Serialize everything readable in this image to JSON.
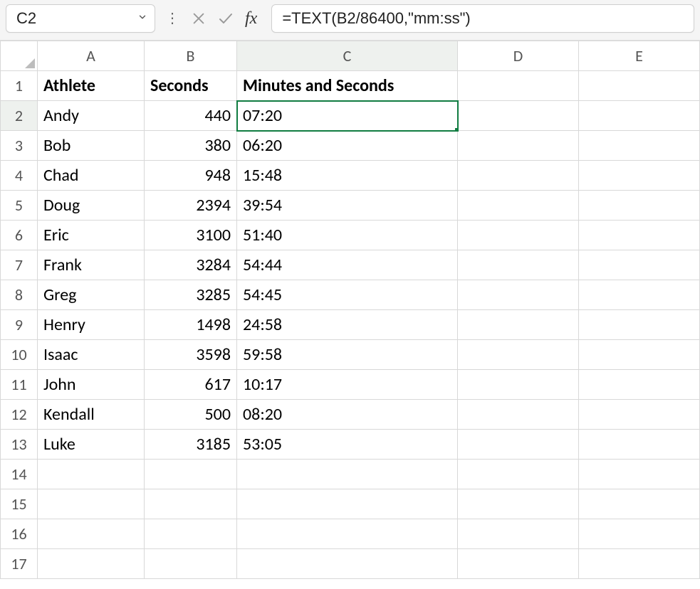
{
  "name_box": {
    "value": "C2"
  },
  "formula_bar": {
    "value": "=TEXT(B2/86400,\"mm:ss\")"
  },
  "fx_label": "fx",
  "columns": [
    "A",
    "B",
    "C",
    "D",
    "E"
  ],
  "visible_row_count": 17,
  "active": {
    "col": "C",
    "row": 2
  },
  "headers": {
    "A": "Athlete",
    "B": "Seconds",
    "C": "Minutes and Seconds"
  },
  "rows": [
    {
      "n": 1,
      "A": "Athlete",
      "B": "Seconds",
      "C": "Minutes and Seconds",
      "D": "",
      "E": "",
      "bold": true
    },
    {
      "n": 2,
      "A": "Andy",
      "B": "440",
      "C": "07:20",
      "D": "",
      "E": ""
    },
    {
      "n": 3,
      "A": "Bob",
      "B": "380",
      "C": "06:20",
      "D": "",
      "E": ""
    },
    {
      "n": 4,
      "A": "Chad",
      "B": "948",
      "C": "15:48",
      "D": "",
      "E": ""
    },
    {
      "n": 5,
      "A": "Doug",
      "B": "2394",
      "C": "39:54",
      "D": "",
      "E": ""
    },
    {
      "n": 6,
      "A": "Eric",
      "B": "3100",
      "C": "51:40",
      "D": "",
      "E": ""
    },
    {
      "n": 7,
      "A": "Frank",
      "B": "3284",
      "C": "54:44",
      "D": "",
      "E": ""
    },
    {
      "n": 8,
      "A": "Greg",
      "B": "3285",
      "C": "54:45",
      "D": "",
      "E": ""
    },
    {
      "n": 9,
      "A": "Henry",
      "B": "1498",
      "C": "24:58",
      "D": "",
      "E": ""
    },
    {
      "n": 10,
      "A": "Isaac",
      "B": "3598",
      "C": "59:58",
      "D": "",
      "E": ""
    },
    {
      "n": 11,
      "A": "John",
      "B": "617",
      "C": "10:17",
      "D": "",
      "E": ""
    },
    {
      "n": 12,
      "A": "Kendall",
      "B": "500",
      "C": "08:20",
      "D": "",
      "E": ""
    },
    {
      "n": 13,
      "A": "Luke",
      "B": "3185",
      "C": "53:05",
      "D": "",
      "E": ""
    },
    {
      "n": 14,
      "A": "",
      "B": "",
      "C": "",
      "D": "",
      "E": ""
    },
    {
      "n": 15,
      "A": "",
      "B": "",
      "C": "",
      "D": "",
      "E": ""
    },
    {
      "n": 16,
      "A": "",
      "B": "",
      "C": "",
      "D": "",
      "E": ""
    },
    {
      "n": 17,
      "A": "",
      "B": "",
      "C": "",
      "D": "",
      "E": ""
    }
  ]
}
